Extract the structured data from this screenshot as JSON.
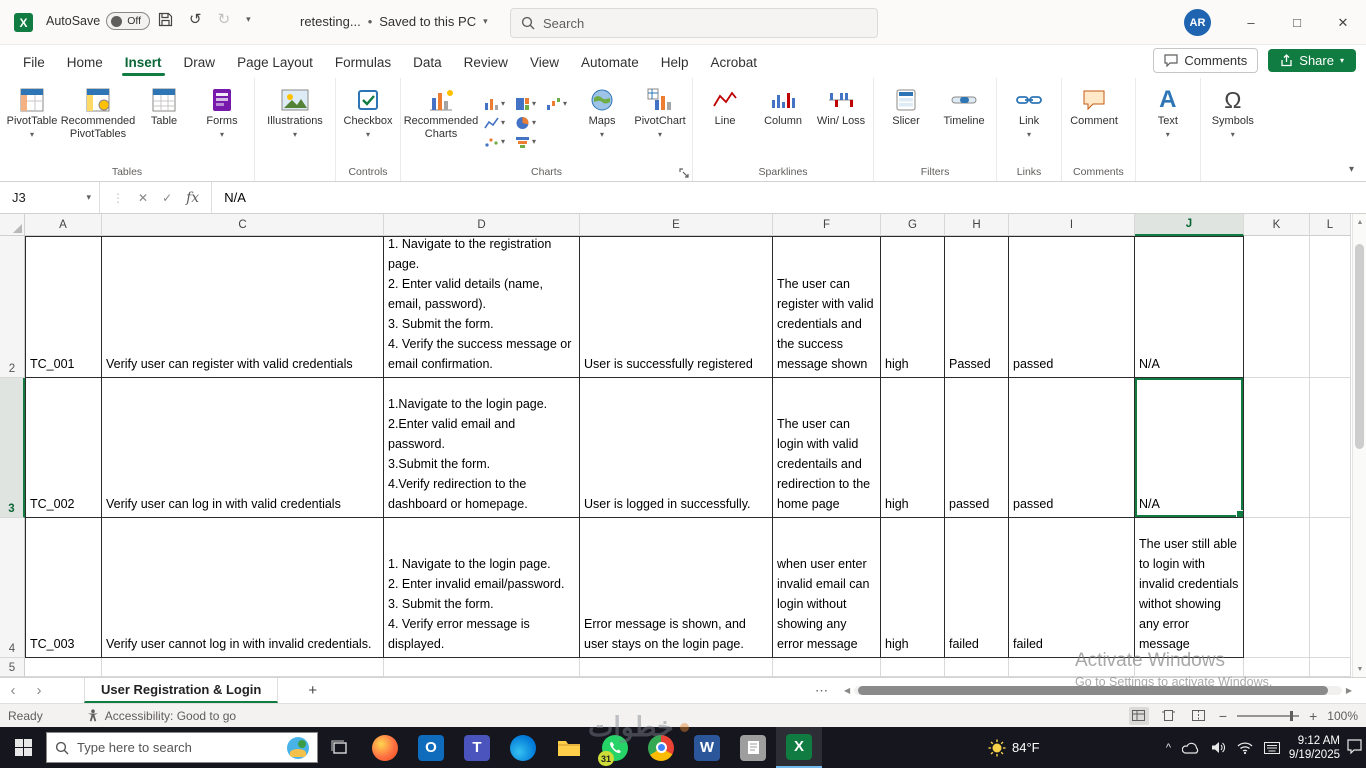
{
  "titlebar": {
    "app_initial": "X",
    "autosave_label": "AutoSave",
    "autosave_state": "Off",
    "doc_name": "retesting...",
    "doc_status": "Saved to this PC",
    "search_placeholder": "Search",
    "avatar_initials": "AR"
  },
  "ribbon_tabs": {
    "items": [
      "File",
      "Home",
      "Insert",
      "Draw",
      "Page Layout",
      "Formulas",
      "Data",
      "Review",
      "View",
      "Automate",
      "Help",
      "Acrobat"
    ],
    "active": "Insert",
    "comments_label": "Comments",
    "share_label": "Share"
  },
  "ribbon": {
    "tables": {
      "group_label": "Tables",
      "pivottable": "PivotTable",
      "recommended_pivottables": "Recommended PivotTables",
      "table": "Table",
      "forms": "Forms"
    },
    "illustrations": {
      "label": "Illustrations"
    },
    "controls": {
      "group_label": "Controls",
      "checkbox": "Checkbox"
    },
    "charts": {
      "group_label": "Charts",
      "recommended_charts": "Recommended Charts",
      "maps": "Maps",
      "pivotchart": "PivotChart"
    },
    "sparklines": {
      "group_label": "Sparklines",
      "line": "Line",
      "column": "Column",
      "winloss": "Win/ Loss"
    },
    "filters": {
      "group_label": "Filters",
      "slicer": "Slicer",
      "timeline": "Timeline"
    },
    "links": {
      "group_label": "Links",
      "link": "Link"
    },
    "comments": {
      "group_label": "Comments",
      "comment": "Comment"
    },
    "text": {
      "label": "Text"
    },
    "symbols": {
      "label": "Symbols"
    }
  },
  "formula_bar": {
    "name_box": "J3",
    "value": "N/A"
  },
  "grid": {
    "columns": [
      "A",
      "C",
      "D",
      "E",
      "F",
      "G",
      "H",
      "I",
      "J",
      "K",
      "L"
    ],
    "selected_cell": "J3",
    "rows": [
      {
        "n": "2",
        "A": "TC_001",
        "C": "Verify user can register with valid credentials",
        "D": "1. Navigate to the registration page.\n2. Enter valid details (name, email, password).\n3. Submit the form.\n4. Verify the success message or email confirmation.",
        "E": "User is successfully registered",
        "F": "The user can register with valid credentials and the success message shown",
        "G": "high",
        "H": "Passed",
        "I": "passed",
        "J": "N/A"
      },
      {
        "n": "3",
        "A": "TC_002",
        "C": "Verify user can log in with valid credentials",
        "D": "1.Navigate to the login page.\n2.Enter valid email and password.\n3.Submit the form.\n4.Verify redirection to the dashboard or homepage.",
        "E": "User is logged in successfully.",
        "F": "The user can login with valid credentails and redirection to the home page",
        "G": "high",
        "H": "passed",
        "I": "passed",
        "J": "N/A"
      },
      {
        "n": "4",
        "A": "TC_003",
        "C": "Verify user cannot log in with invalid credentials.",
        "D": "1. Navigate to the login page.\n2. Enter invalid email/password.\n3. Submit the form.\n4. Verify error message is displayed.",
        "E": "Error message is shown, and user stays on the login page.",
        "F": "when user enter invalid email can login without showing any error message",
        "G": "high",
        "H": "failed",
        "I": "failed",
        "J": "The user still able to login with invalid credentials withot showing any error message"
      },
      {
        "n": "5",
        "A": "",
        "C": "",
        "D": "",
        "E": "",
        "F": "",
        "G": "",
        "H": "",
        "I": "",
        "J": ""
      }
    ]
  },
  "sheet_bar": {
    "tab": "User Registration & Login"
  },
  "status_bar": {
    "ready": "Ready",
    "accessibility": "Accessibility: Good to go",
    "zoom": "100%"
  },
  "watermark": {
    "activate_line1": "Activate Windows",
    "activate_line2": "Go to Settings to activate Windows.",
    "logo_text": "خطوات"
  },
  "taskbar": {
    "search_placeholder": "Type here to search",
    "weather_temp": "84°F",
    "whatsapp_badge": "31",
    "time": "9:12 AM",
    "date": "9/19/2025"
  },
  "icons": {
    "caret": "▾",
    "undo": "↺",
    "redo": "↻",
    "bullet": "•",
    "minimize": "–",
    "maximize": "□",
    "close": "✕",
    "omega": "Ω",
    "cancel": "✕",
    "enter": "✓",
    "fx": "fx",
    "dots": "⋮",
    "up": "▲",
    "down": "▼",
    "left": "◀",
    "right": "▶",
    "tab_left": "‹",
    "tab_right": "›",
    "plus": "+",
    "minus": "−",
    "ellipsis": "⋯",
    "text_a": "A",
    "chevron_up": "^"
  }
}
